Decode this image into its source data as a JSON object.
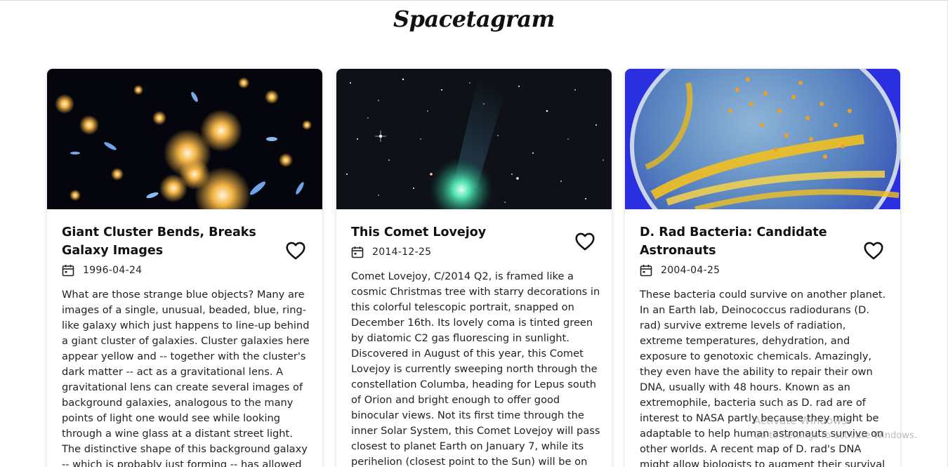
{
  "header": {
    "logo_text": "Spacetagram"
  },
  "cards": [
    {
      "image_desc": "galaxy-cluster-image",
      "title": "Giant Cluster Bends, Breaks Galaxy Images",
      "date": "1996-04-24",
      "description": "What are those strange blue objects? Many are images of a single, unusual, beaded, blue, ring-like galaxy which just happens to line-up behind a giant cluster of galaxies. Cluster galaxies here appear yellow and -- together with the cluster's dark matter -- act as a gravitational lens. A gravitational lens can create several images of background galaxies, analogous to the many points of light one would see while looking through a wine glass at a distant street light. The distinctive shape of this background galaxy -- which is probably just forming -- has allowed",
      "liked": false
    },
    {
      "image_desc": "comet-lovejoy-image",
      "title": "This Comet Lovejoy",
      "date": "2014-12-25",
      "description": "Comet Lovejoy, C/2014 Q2, is framed like a cosmic Christmas tree with starry decorations in this colorful telescopic portrait, snapped on December 16th. Its lovely coma is tinted green by diatomic C2 gas fluorescing in sunlight. Discovered in August of this year, this Comet Lovejoy is currently sweeping north through the constellation Columba, heading for Lepus south of Orion and bright enough to offer good binocular views. Not its first time through the inner Solar System, this Comet Lovejoy will pass closest to planet Earth on January 7, while its perihelion (closest point to the Sun) will be on",
      "liked": false
    },
    {
      "image_desc": "bacteria-petri-dish-image",
      "title": "D. Rad Bacteria: Candidate Astronauts",
      "date": "2004-04-25",
      "description": "These bacteria could survive on another planet. In an Earth lab, Deinococcus radiodurans (D. rad) survive extreme levels of radiation, extreme temperatures, dehydration, and exposure to genotoxic chemicals. Amazingly, they even have the ability to repair their own DNA, usually with 48 hours. Known as an extremophile, bacteria such as D. rad are of interest to NASA partly because they might be adaptable to help human astronauts survive on other worlds. A recent map of D. rad's DNA might allow biologists to augment their survival skills with the ability to",
      "liked": false
    }
  ],
  "watermark": {
    "line1": "Activate Windows",
    "line2": "Go to Settings to activate Windows."
  },
  "colors": {
    "heart": "#111111",
    "text": "#222222",
    "card_shadow": "rgba(0,0,0,0.16)"
  }
}
